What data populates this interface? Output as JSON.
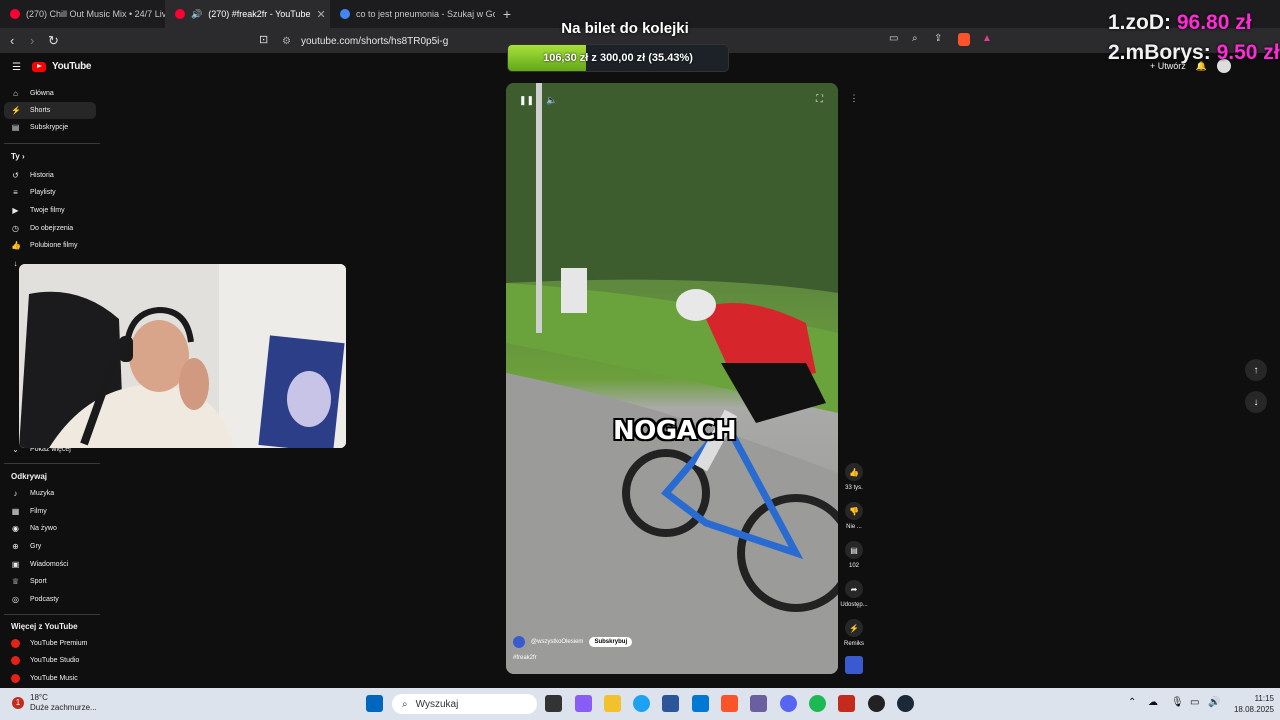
{
  "browser": {
    "tabs": [
      {
        "title": "(270) Chill Out Music Mix • 24/7 Live",
        "active": false
      },
      {
        "title": "(270) #freak2fr - YouTube",
        "active": true
      },
      {
        "title": "co to jest pneumonia - Szukaj w Goo",
        "active": false
      }
    ],
    "url": "youtube.com/shorts/hs8TR0p5i-g"
  },
  "overlay": {
    "goal_title": "Na bilet do kolejki",
    "goal_text": "106,30 zł z 300,00 zł (35.43%)",
    "goal_fraction": 0.3543,
    "leaderboard": [
      {
        "rank": "1.",
        "name": "zoD:",
        "amount": "96.80 zł"
      },
      {
        "rank": "2.",
        "name": "mBorys:",
        "amount": "9.50 zł"
      }
    ]
  },
  "youtube": {
    "logo": "YouTube",
    "create_label": "Utwórz",
    "sidebar": {
      "main": [
        "Główna",
        "Shorts",
        "Subskrypcje"
      ],
      "you_heading": "Ty",
      "you": [
        "Historia",
        "Playlisty",
        "Twoje filmy",
        "Do obejrzenia",
        "Polubione filmy"
      ],
      "show_more": "Pokaż więcej",
      "explore_heading": "Odkrywaj",
      "explore": [
        "Muzyka",
        "Filmy",
        "Na żywo",
        "Gry",
        "Wiadomości",
        "Sport",
        "Podcasty"
      ],
      "more_heading": "Więcej z YouTube",
      "more": [
        "YouTube Premium",
        "YouTube Studio",
        "YouTube Music"
      ]
    },
    "short": {
      "caption": "NOGACH",
      "channel": "@wszystkoOlesiem",
      "subscribe": "Subskrybuj",
      "hashtag": "#freak2fr",
      "likes": "33 tys.",
      "dislike": "Nie ...",
      "comments": "102",
      "share": "Udostęp...",
      "remix": "Remiks"
    }
  },
  "taskbar": {
    "weather_temp": "18°C",
    "weather_desc": "Duże zachmurze...",
    "search_placeholder": "Wyszukaj",
    "time": "11:15",
    "date": "18.08.2025"
  }
}
